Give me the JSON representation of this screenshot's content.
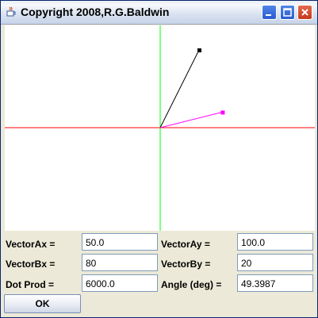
{
  "window": {
    "title": "Copyright 2008,R.G.Baldwin",
    "controls": {
      "minimize": "minimize-icon",
      "maximize": "maximize-icon",
      "close": "close-icon"
    }
  },
  "plot": {
    "background": "#ffffff",
    "x_axis_color": "#ff0000",
    "y_axis_color": "#00ff00",
    "vector_a": {
      "x": 50.0,
      "y": 100.0,
      "color": "#000000"
    },
    "vector_b": {
      "x": 80,
      "y": 20,
      "color": "#ff00ff"
    }
  },
  "form": {
    "vector_ax": {
      "label": "VectorAx =",
      "value": "50.0"
    },
    "vector_ay": {
      "label": "VectorAy =",
      "value": "100.0"
    },
    "vector_bx": {
      "label": "VectorBx =",
      "value": "80"
    },
    "vector_by": {
      "label": "VectorBy =",
      "value": "20"
    },
    "dot_prod": {
      "label": "Dot Prod =",
      "value": "6000.0"
    },
    "angle": {
      "label": "Angle (deg) =",
      "value": "49.3987"
    }
  },
  "ok_button": {
    "label": "OK"
  }
}
